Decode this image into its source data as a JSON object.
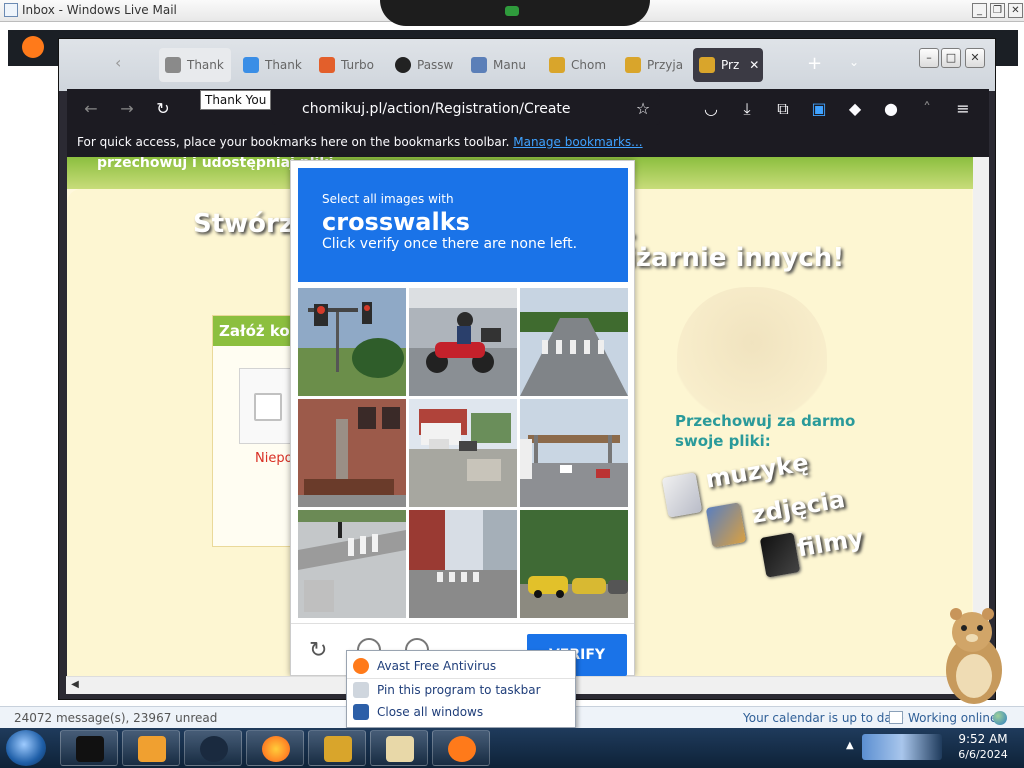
{
  "livemail": {
    "title": "Inbox - Windows Live Mail",
    "status_count": "24072 message(s), 23967 unread",
    "status_calendar": "Your calendar is up to date",
    "status_online": "Working online"
  },
  "firefox": {
    "tabs": [
      {
        "label": "Thank",
        "favicon": "cube-icon",
        "color": "#8a8a8a"
      },
      {
        "label": "Thank",
        "favicon": "cube-icon",
        "color": "#3a8ee6"
      },
      {
        "label": "Turbo",
        "favicon": "cube-icon",
        "color": "#e35f2b"
      },
      {
        "label": "Passw",
        "favicon": "passwords-icon",
        "color": "#222222"
      },
      {
        "label": "Manu",
        "favicon": "manual-icon",
        "color": "#5b7fb8"
      },
      {
        "label": "Chom",
        "favicon": "chomikuj-icon",
        "color": "#d9a52b"
      },
      {
        "label": "Przyja",
        "favicon": "chomikuj-icon",
        "color": "#d9a52b"
      },
      {
        "label": "Prz",
        "favicon": "chomikuj-icon",
        "color": "#d9a52b"
      }
    ],
    "url": "chomikuj.pl/action/Registration/Create",
    "bookmarks_text": "For quick access, place your bookmarks here on the bookmarks toolbar.",
    "bookmarks_link": "Manage bookmarks...",
    "tooltip": "Thank You"
  },
  "page": {
    "header_text": "przechowuj i udostępniaj pliki",
    "headline_left": "Stwórz",
    "headline_right_top": "...",
    "headline_right": "iżarnie innych!",
    "form_title": "Załóż ko",
    "form_error": "Niepo",
    "side_title": "Przechowuj za darmo swoje pliki:",
    "media": [
      "muzykę",
      "zdjęcia",
      "filmy"
    ]
  },
  "captcha": {
    "instruction_1": "Select all images with",
    "instruction_target": "crosswalks",
    "instruction_2": "Click verify once there are none left.",
    "verify_label": "VERIFY",
    "accent": "#1a73e8",
    "tiles": [
      {
        "scene": "traffic-light"
      },
      {
        "scene": "motorcycle"
      },
      {
        "scene": "crosswalk-road"
      },
      {
        "scene": "brick-building"
      },
      {
        "scene": "street-houses"
      },
      {
        "scene": "highway-bridge"
      },
      {
        "scene": "crosswalk-corner"
      },
      {
        "scene": "crosswalk-street"
      },
      {
        "scene": "parked-cars"
      }
    ]
  },
  "jumplist": {
    "items": [
      {
        "label": "Avast Free Antivirus",
        "icon": "avast-icon"
      },
      {
        "label": "Pin this program to taskbar",
        "icon": "pin-icon"
      },
      {
        "label": "Close all windows",
        "icon": "close-window-icon"
      }
    ]
  },
  "taskbar": {
    "time": "9:52 AM",
    "date": "6/6/2024"
  }
}
